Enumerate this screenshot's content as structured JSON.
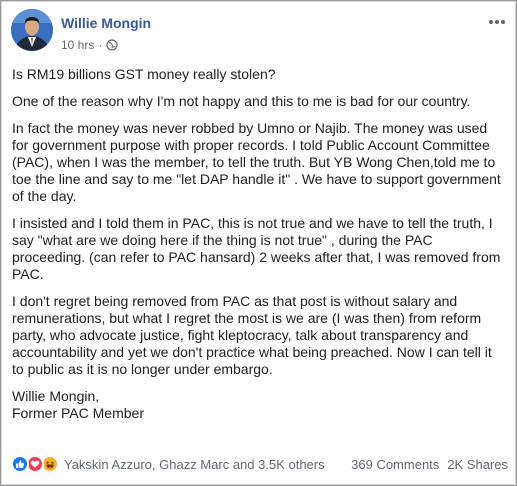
{
  "post": {
    "author": "Willie Mongin",
    "time": "10 hrs",
    "separator": "·",
    "paragraphs": [
      "Is RM19 billions GST money really stolen?",
      "One of the reason why I'm not happy and this to me is bad for our country.",
      "In fact the money was never robbed by Umno or Najib. The money was used for government purpose with proper records. I told Public Account Committee (PAC), when I was the member, to tell the truth. But YB Wong Chen,told me to toe the line and say to me \"let DAP handle it\" . We have to support government of the day.",
      "I insisted and I told them in PAC, this is not true and we have to tell the truth, I say \"what are we doing here if the thing is not true\" , during the PAC proceeding. (can refer to PAC hansard) 2 weeks after that, I was removed from PAC.",
      "I don't regret being removed from PAC as that post is without salary and remunerations, but what I regret the most is we are (I was then) from reform party, who advocate justice, fight kleptocracy, talk about transparency and accountability and yet we don't practice what being preached. Now I can tell it to public as it is no longer under embargo."
    ],
    "signature_name": "Willie Mongin,",
    "signature_title": "Former PAC Member"
  },
  "footer": {
    "reaction_icons": [
      "like-icon",
      "love-icon",
      "haha-icon"
    ],
    "reaction_names": "Yakskin Azzuro, Ghazz Marc and 3.5K others",
    "comments": "369 Comments",
    "shares": "2K Shares"
  },
  "colors": {
    "author": "#385898",
    "like": "#1877f2",
    "love": "#f33e58",
    "haha": "#f7b125",
    "meta": "#616770"
  }
}
